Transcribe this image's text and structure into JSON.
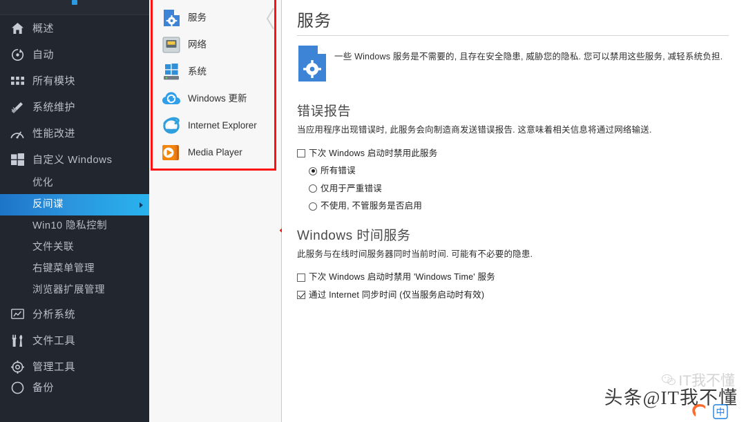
{
  "sidebar": {
    "items": [
      {
        "label": "概述",
        "icon": "home-icon",
        "type": "top",
        "active": false
      },
      {
        "label": "自动",
        "icon": "auto-icon",
        "type": "top",
        "active": false
      },
      {
        "label": "所有模块",
        "icon": "modules-icon",
        "type": "top",
        "active": false
      },
      {
        "label": "系统维护",
        "icon": "broom-icon",
        "type": "top",
        "active": false
      },
      {
        "label": "性能改进",
        "icon": "gauge-icon",
        "type": "top",
        "active": false
      },
      {
        "label": "自定义 Windows",
        "icon": "windows-icon",
        "type": "top",
        "active": false
      },
      {
        "label": "优化",
        "icon": "none",
        "type": "sub",
        "active": false
      },
      {
        "label": "反间谍",
        "icon": "none",
        "type": "sub",
        "active": true
      },
      {
        "label": "Win10 隐私控制",
        "icon": "none",
        "type": "sub",
        "active": false
      },
      {
        "label": "文件关联",
        "icon": "none",
        "type": "sub",
        "active": false
      },
      {
        "label": "右键菜单管理",
        "icon": "none",
        "type": "sub",
        "active": false
      },
      {
        "label": "浏览器扩展管理",
        "icon": "none",
        "type": "sub",
        "active": false
      },
      {
        "label": "分析系统",
        "icon": "analyze-icon",
        "type": "top",
        "active": false
      },
      {
        "label": "文件工具",
        "icon": "tools-icon",
        "type": "top",
        "active": false
      },
      {
        "label": "管理工具",
        "icon": "settings-icon",
        "type": "top",
        "active": false
      },
      {
        "label": "备份",
        "icon": "backup-icon",
        "type": "top",
        "active": false
      }
    ]
  },
  "submenu": {
    "items": [
      {
        "label": "服务",
        "icon": "service-doc-icon"
      },
      {
        "label": "网络",
        "icon": "network-port-icon"
      },
      {
        "label": "系统",
        "icon": "system-pc-icon"
      },
      {
        "label": "Windows 更新",
        "icon": "windows-update-icon"
      },
      {
        "label": "Internet Explorer",
        "icon": "internet-explorer-icon"
      },
      {
        "label": "Media Player",
        "icon": "media-player-icon"
      }
    ]
  },
  "main": {
    "page_title": "服务",
    "intro_text": "一些 Windows 服务是不需要的, 且存在安全隐患, 威胁您的隐私. 您可以禁用这些服务, 减轻系统负担.",
    "sections": [
      {
        "title": "错误报告",
        "desc": "当应用程序出现错误时, 此服务会向制造商发送错误报告. 这意味着相关信息将通过网络输送.",
        "checkbox": {
          "label": "下次 Windows 启动时禁用此服务",
          "checked": false
        },
        "radios": [
          {
            "label": "所有错误",
            "selected": true
          },
          {
            "label": "仅用于严重错误",
            "selected": false
          },
          {
            "label": "不使用, 不管服务是否启用",
            "selected": false
          }
        ]
      },
      {
        "title": "Windows 时间服务",
        "desc": "此服务与在线时间服务器同时当前时间. 可能有不必要的隐患.",
        "checkboxes": [
          {
            "label": "下次 Windows 启动时禁用 'Windows Time' 服务",
            "checked": false
          },
          {
            "label": "通过 Internet 同步时间 (仅当服务启动时有效)",
            "checked": true
          }
        ]
      }
    ]
  },
  "watermark": {
    "main": "头条@IT我不懂",
    "ghost": "IT我不懂"
  },
  "colors": {
    "sidebar_bg": "#22262e",
    "accent_blue": "#2b93dd",
    "accent_cyan": "#29b3ee",
    "annotation_red": "#ff1111",
    "panel_bg": "#f7f7f7"
  }
}
